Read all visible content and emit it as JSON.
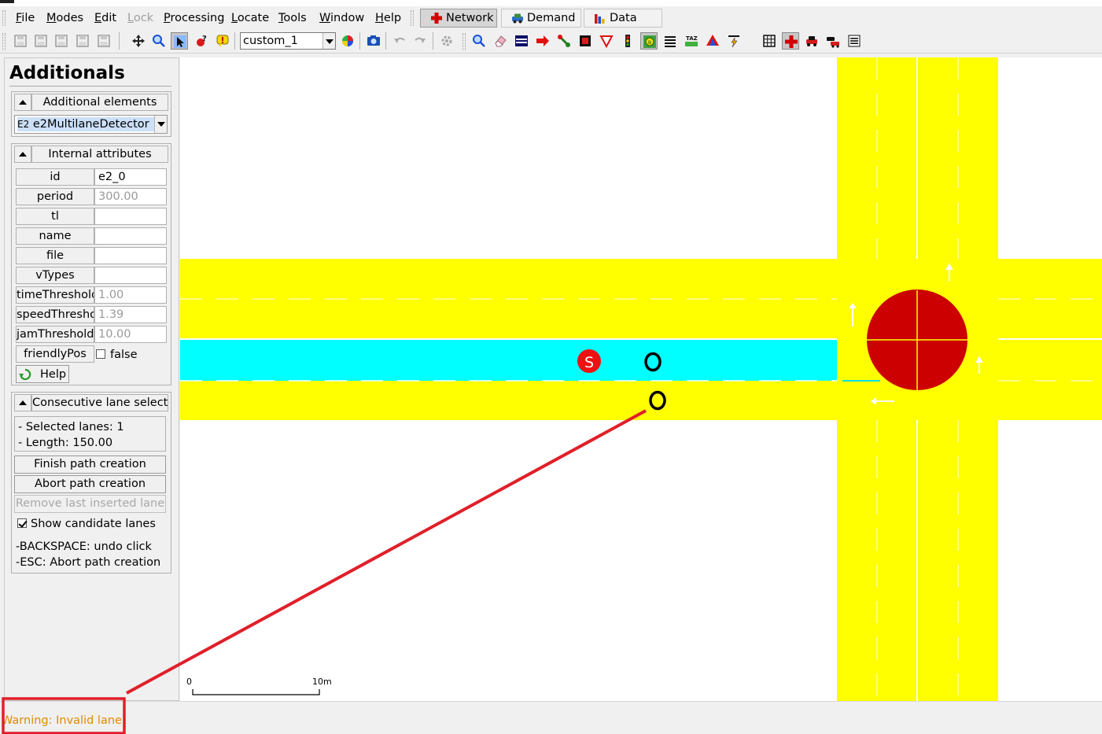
{
  "menu": {
    "items": [
      {
        "mnemonic": "F",
        "rest": "ile",
        "disabled": false
      },
      {
        "mnemonic": "M",
        "rest": "odes",
        "disabled": false
      },
      {
        "mnemonic": "E",
        "rest": "dit",
        "disabled": false
      },
      {
        "mnemonic": "L",
        "rest": "ock",
        "disabled": true
      },
      {
        "mnemonic": "P",
        "rest": "rocessing",
        "disabled": false
      },
      {
        "mnemonic": "L",
        "rest": "ocate",
        "disabled": false
      },
      {
        "mnemonic": "T",
        "rest": "ools",
        "disabled": false
      },
      {
        "mnemonic": "W",
        "rest": "indow",
        "disabled": false
      },
      {
        "mnemonic": "H",
        "rest": "elp",
        "disabled": false
      }
    ]
  },
  "supermodes": {
    "network": "Network",
    "demand": "Demand",
    "data": "Data",
    "active": "network"
  },
  "toolbar": {
    "view_scheme": "custom_1"
  },
  "panel": {
    "title": "Additionals",
    "additional_elements": {
      "header": "Additional elements",
      "selected_tag": "E2",
      "selected": "e2MultilaneDetector"
    },
    "internal_attributes": {
      "header": "Internal attributes",
      "rows": [
        {
          "label": "id",
          "value": "e2_0",
          "is_default": false
        },
        {
          "label": "period",
          "value": "300.00",
          "is_default": true
        },
        {
          "label": "tl",
          "value": "",
          "is_default": false
        },
        {
          "label": "name",
          "value": "",
          "is_default": false
        },
        {
          "label": "file",
          "value": "",
          "is_default": false
        },
        {
          "label": "vTypes",
          "value": "",
          "is_default": false
        },
        {
          "label": "timeThreshold",
          "value": "1.00",
          "is_default": true
        },
        {
          "label": "speedThreshold",
          "value": "1.39",
          "is_default": true
        },
        {
          "label": "jamThreshold",
          "value": "10.00",
          "is_default": true
        }
      ],
      "friendly_pos_label": "friendlyPos",
      "friendly_pos_value": "false",
      "help_label": "Help"
    },
    "consecutive_lane_selector": {
      "header": "Consecutive lane selector",
      "selected_lanes": "- Selected lanes: 1",
      "length": "- Length: 150.00",
      "finish_label": "Finish path creation",
      "abort_label": "Abort path creation",
      "remove_label": "Remove last inserted lane",
      "show_candidates_label": "Show candidate lanes",
      "show_candidates_checked": true,
      "hint_backspace": "-BACKSPACE: undo click",
      "hint_esc": "-ESC: Abort path creation"
    }
  },
  "canvas": {
    "start_marker_letter": "S",
    "scale_start": "0",
    "scale_end": "10m",
    "colors": {
      "road": "#ffff00",
      "selected_lane": "#00ffff",
      "junction_tls": "#cc0000",
      "start_marker": "#ee1111",
      "annotation": "#e0202a"
    }
  },
  "status": {
    "message": "Warning: Invalid lane"
  }
}
